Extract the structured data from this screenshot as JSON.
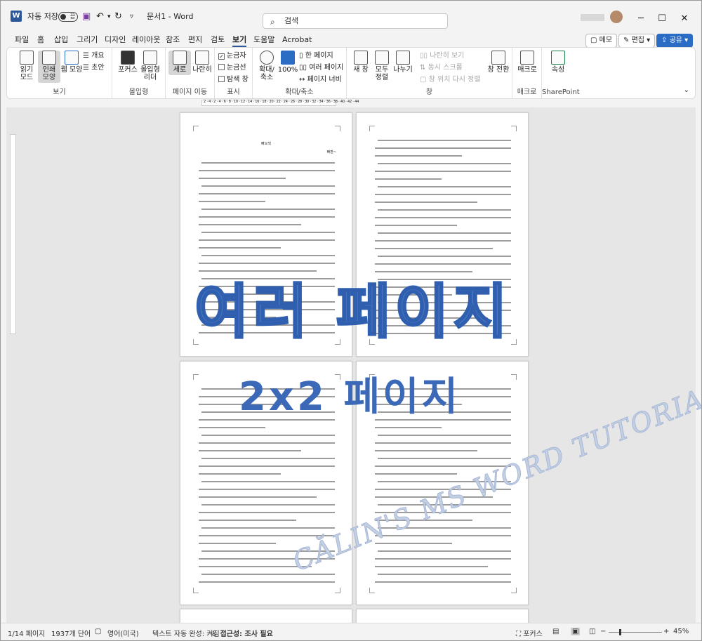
{
  "titlebar": {
    "autosave_label": "자동 저장",
    "autosave_state": "끔",
    "doc_title": "문서1  -  Word",
    "search_placeholder": "검색"
  },
  "tabs": [
    "파일",
    "홈",
    "삽입",
    "그리기",
    "디자인",
    "레이아웃",
    "참조",
    "편지",
    "검토",
    "보기",
    "도움말",
    "Acrobat"
  ],
  "active_tab": "보기",
  "right_buttons": {
    "memo": "메모",
    "edit": "편집",
    "share": "공유"
  },
  "ribbon": {
    "view": {
      "label": "보기",
      "read": "읽기\n모드",
      "print": "인쇄\n모양",
      "web": "웹 모양",
      "outline": "개요",
      "draft": "초안"
    },
    "immersive": {
      "label": "몰입형",
      "focus": "포커스",
      "reader": "몰입형\n리더"
    },
    "move": {
      "label": "페이지 이동",
      "vertical": "세로",
      "side": "나란히"
    },
    "show": {
      "label": "표시",
      "ruler": "눈금자",
      "gridlines": "눈금선",
      "nav": "탐색 창"
    },
    "zoom": {
      "label": "확대/축소",
      "zoom": "확대/\n축소",
      "p100": "100%",
      "one": "한 페이지",
      "multi": "여러 페이지",
      "width": "페이지 너비"
    },
    "window": {
      "label": "창",
      "new": "새 창",
      "arrange": "모두\n정렬",
      "split": "나누기",
      "side_by_side": "나란히 보기",
      "sync": "동시 스크롤",
      "reset": "창 위치 다시 정렬",
      "switch": "창 전환"
    },
    "macro": {
      "label": "매크로",
      "macro": "매크로"
    },
    "sharepoint": {
      "label": "SharePoint",
      "props": "속성"
    }
  },
  "ruler_ticks": "2 · 4 · 2 · 4 · 6 · 8 · 10 · 12 · 14 · 16 · 18 · 20 · 22 · 24 · 26 · 28 · 30 · 32 · 34 · 36 · 38 · 40 · 42 · 44",
  "page1": {
    "title": "빠오색",
    "author": "빠판~"
  },
  "overlay_title": "여러 페이지",
  "overlay_subtitle": "2x2 페이지",
  "watermark": "CĂLIN'S MS WORD TUTORIALS",
  "status": {
    "page": "1/14 페이지",
    "words": "1937개 단어",
    "lang": "영어(미국)",
    "predict": "텍스트 자동 완성: 켜짐",
    "access": "접근성: 조사 필요",
    "focus": "포커스",
    "zoom": "45%"
  },
  "zoom_level": 0.45
}
